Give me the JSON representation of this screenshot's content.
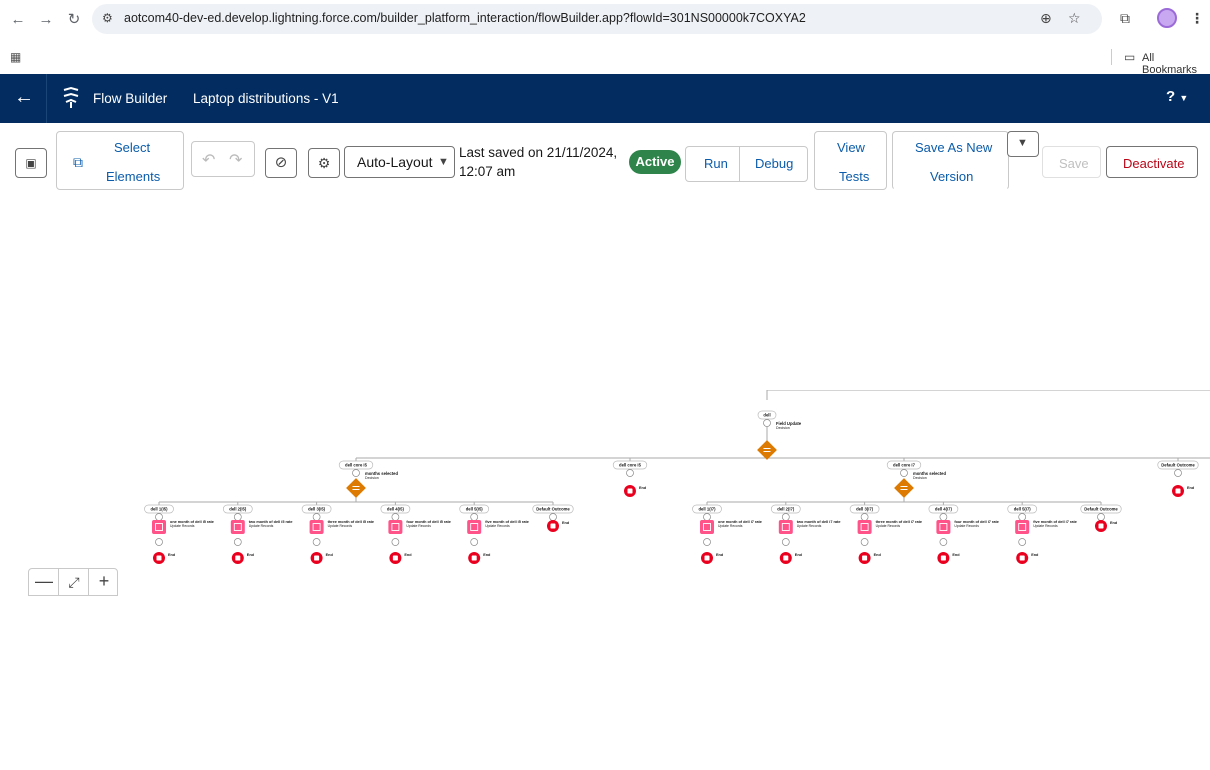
{
  "browser": {
    "url": "aotcom40-dev-ed.develop.lightning.force.com/builder_platform_interaction/flowBuilder.app?flowId=301NS00000k7COXYA2",
    "bookmarks_label": "All Bookmarks",
    "icons": [
      "back-icon",
      "forward-icon",
      "reload-icon",
      "site-settings-icon",
      "zoom-icon",
      "star-icon",
      "extensions-icon",
      "profile-avatar",
      "kebab-menu-icon",
      "apps-icon",
      "folder-icon"
    ]
  },
  "header": {
    "app_name": "Flow Builder",
    "flow_name": "Laptop distributions - V1",
    "help_label": "?"
  },
  "toolbar": {
    "select_elements": [
      "Select",
      "Elements"
    ],
    "layout_select": "Auto-Layout",
    "last_saved": [
      "Last saved on 21/11/2024,",
      "12:07 am"
    ],
    "status": "Active",
    "run": "Run",
    "debug": "Debug",
    "view_tests": [
      "View",
      "Tests"
    ],
    "save_as_new": [
      "Save As New",
      "Version"
    ],
    "save": "Save",
    "deactivate": "Deactivate",
    "colors": {
      "primary": "#0b5cab",
      "active": "#2e844a",
      "deactivate": "#ba0517",
      "header": "#032d60"
    }
  },
  "canvas": {
    "root": {
      "label": "dell",
      "title": "Field Update",
      "subtitle": "Decision"
    },
    "branches": [
      {
        "label": "dell core i5",
        "decision": {
          "title": "months selected",
          "subtitle": "Decision"
        },
        "children": [
          {
            "label": "dell 1(i5)",
            "title": "one month of dell i5 rate",
            "subtitle": "Update Records"
          },
          {
            "label": "dell 2(i5)",
            "title": "two month of dell i5 rate",
            "subtitle": "Update Records"
          },
          {
            "label": "dell 3(i5)",
            "title": "three month of dell i5 rate",
            "subtitle": "Update Records"
          },
          {
            "label": "dell 4(i5)",
            "title": "four month of dell i5 rate",
            "subtitle": "Update Records"
          },
          {
            "label": "dell 5(i5)",
            "title": "five month of dell i5 rate",
            "subtitle": "Update Records"
          },
          {
            "label": "Default Outcome",
            "title": "",
            "subtitle": ""
          }
        ]
      },
      {
        "label": "dell core i5",
        "decision": null,
        "children": []
      },
      {
        "label": "dell core i7",
        "decision": {
          "title": "months selected",
          "subtitle": "Decision"
        },
        "children": [
          {
            "label": "dell 1(i7)",
            "title": "one month of dell i7 rate",
            "subtitle": "Update Records"
          },
          {
            "label": "dell 2(i7)",
            "title": "two month of dell i7 rate",
            "subtitle": "Update Records"
          },
          {
            "label": "dell 3(i7)",
            "title": "three month of dell i7 rate",
            "subtitle": "Update Records"
          },
          {
            "label": "dell 4(i7)",
            "title": "four month of dell i7 rate",
            "subtitle": "Update Records"
          },
          {
            "label": "dell 5(i7)",
            "title": "five month of dell i7 rate",
            "subtitle": "Update Records"
          },
          {
            "label": "Default Outcome",
            "title": "",
            "subtitle": ""
          }
        ]
      },
      {
        "label": "Default Outcome",
        "decision": null,
        "children": []
      }
    ],
    "end_label": "End"
  },
  "zoom_controls": {
    "zoom_out": "—",
    "fit": "⤢",
    "zoom_in": "+"
  }
}
